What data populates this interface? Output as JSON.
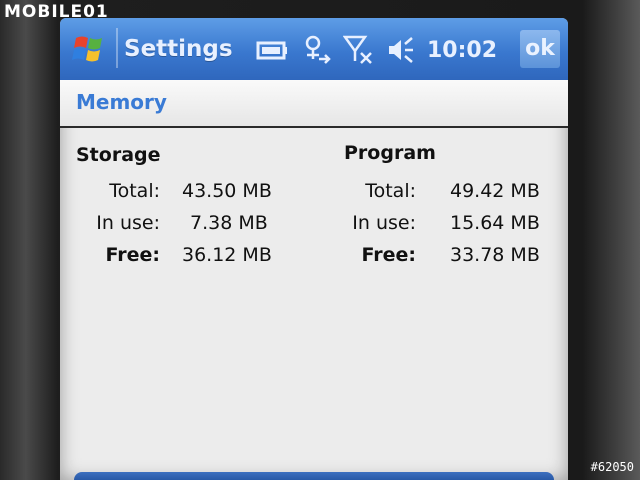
{
  "watermark": {
    "brand": "MOBILE01",
    "image_id": "#62050"
  },
  "titlebar": {
    "app_title": "Settings",
    "clock": "10:02",
    "ok_label": "ok"
  },
  "page": {
    "title": "Memory"
  },
  "storage": {
    "title": "Storage",
    "rows": [
      {
        "label": "Total:",
        "value": "43.50 MB"
      },
      {
        "label": "In use:",
        "value": "7.38 MB"
      },
      {
        "label": "Free:",
        "value": "36.12 MB"
      }
    ]
  },
  "program": {
    "title": "Program",
    "rows": [
      {
        "label": "Total:",
        "value": "49.42 MB"
      },
      {
        "label": "In use:",
        "value": "15.64 MB"
      },
      {
        "label": "Free:",
        "value": "33.78 MB"
      }
    ]
  },
  "icons": [
    "windows-start-icon",
    "battery-icon",
    "connectivity-icon",
    "signal-off-icon",
    "volume-icon"
  ],
  "colors": {
    "titlebar": "#3a78cf",
    "title_text": "#3a7bd5",
    "screen_bg": "#ececec"
  }
}
